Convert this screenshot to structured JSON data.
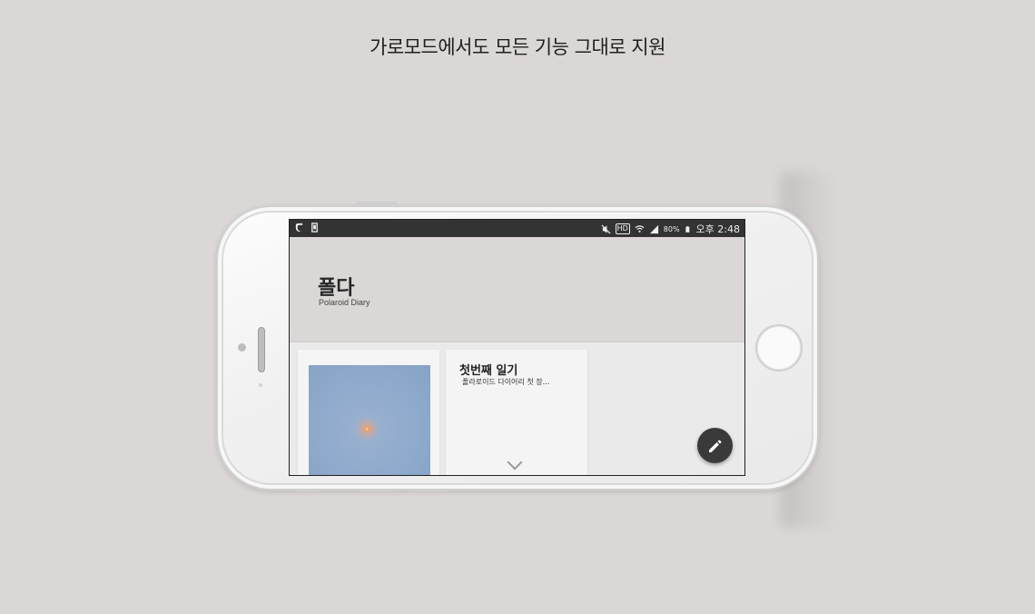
{
  "headline": "가로모드에서도 모든 기능 그대로 지원",
  "statusbar": {
    "hd": "HD",
    "battery_percent": "80%",
    "time": "오후 2:48",
    "icons": [
      "app-notification-icon",
      "screenshot-icon",
      "mute-icon",
      "hd-icon",
      "wifi-icon",
      "signal-icon",
      "battery-icon"
    ]
  },
  "app": {
    "title": "폴다",
    "subtitle": "Polaroid Diary"
  },
  "cards": [
    {
      "type": "photo",
      "photo_color": "#8ea9cc"
    },
    {
      "type": "text",
      "title": "첫번째 일기",
      "snippet": "폴라로이드 다이어리 첫 장…"
    }
  ],
  "fab": {
    "icon": "pencil-icon"
  },
  "colors": {
    "background": "#dbd7d6",
    "statusbar": "#333333",
    "fab": "#3a3a3a"
  }
}
